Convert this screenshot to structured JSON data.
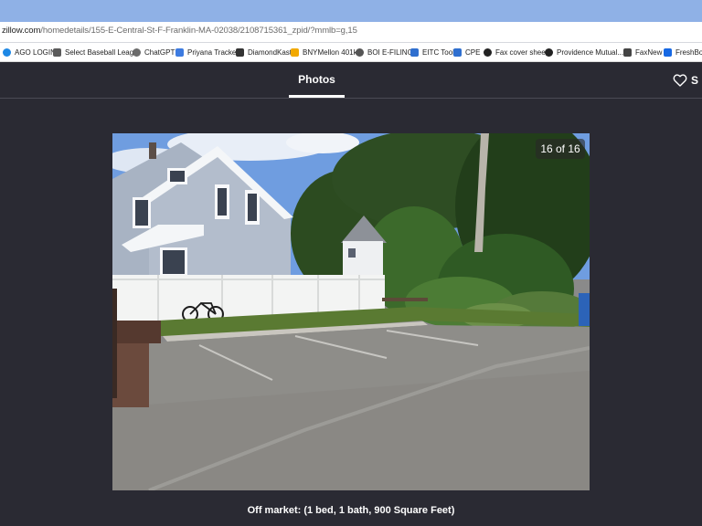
{
  "browser": {
    "url_host": "zillow.com",
    "url_path": "/homedetails/155-E-Central-St-F-Franklin-MA-02038/2108715361_zpid/?mmlb=g,15",
    "bookmarks": [
      {
        "label": "AGO LOGIN",
        "icon": "cloud-icon",
        "color": "#1e88e5"
      },
      {
        "label": "Select Baseball Leag...",
        "icon": "site-icon",
        "color": "#5a5a5a"
      },
      {
        "label": "ChatGPT",
        "icon": "chatgpt-icon",
        "color": "#6b6b6b"
      },
      {
        "label": "Priyana Tracker",
        "icon": "sheets-icon",
        "color": "#3d7be0"
      },
      {
        "label": "DiamondKast",
        "icon": "diamond-icon",
        "color": "#333333"
      },
      {
        "label": "BNYMellon 401k",
        "icon": "bank-icon",
        "color": "#f2a900"
      },
      {
        "label": "BOI E-FILING",
        "icon": "globe-icon",
        "color": "#555555"
      },
      {
        "label": "EITC Tool",
        "icon": "document-icon",
        "color": "#2f6fcf"
      },
      {
        "label": "CPE",
        "icon": "document-icon",
        "color": "#2f6fcf"
      },
      {
        "label": "Fax cover sheet",
        "icon": "globe-icon",
        "color": "#222222"
      },
      {
        "label": "Providence Mutual...",
        "icon": "globe-icon",
        "color": "#222222"
      },
      {
        "label": "FaxNew",
        "icon": "fax-icon",
        "color": "#444444"
      },
      {
        "label": "FreshBook",
        "icon": "freshbooks-icon",
        "color": "#1668e3"
      }
    ]
  },
  "header": {
    "tab_label": "Photos",
    "save_label": "S"
  },
  "photo": {
    "counter": "16 of 16"
  },
  "caption": "Off market: (1 bed, 1 bath, 900 Square Feet)"
}
